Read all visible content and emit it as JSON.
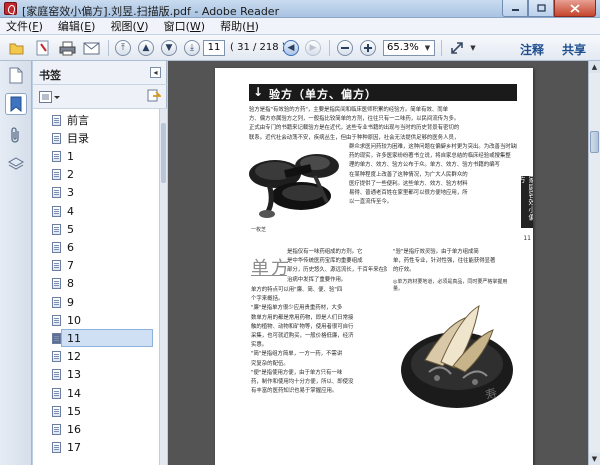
{
  "window": {
    "title": "[家庭窑效小偏方].刘昱.扫描版.pdf - Adobe Reader",
    "min_icon": "minimize-glyph",
    "max_icon": "maximize-glyph",
    "close_icon": "close-glyph"
  },
  "menu": {
    "items": [
      {
        "label": "文件(",
        "key": "F",
        "end": ")"
      },
      {
        "label": "编辑(",
        "key": "E",
        "end": ")"
      },
      {
        "label": "视图(",
        "key": "V",
        "end": ")"
      },
      {
        "label": "窗口(",
        "key": "W",
        "end": ")"
      },
      {
        "label": "帮助(",
        "key": "H",
        "end": ")"
      }
    ]
  },
  "toolbar": {
    "page_value": "11",
    "page_count": "( 31 / 218 )",
    "zoom_value": "65.3%",
    "annotate_label": "注释",
    "share_label": "共享"
  },
  "bookmarks": {
    "title": "书签",
    "items": [
      {
        "label": "前言"
      },
      {
        "label": "目录"
      },
      {
        "label": "1"
      },
      {
        "label": "2"
      },
      {
        "label": "3"
      },
      {
        "label": "4"
      },
      {
        "label": "5"
      },
      {
        "label": "6"
      },
      {
        "label": "7"
      },
      {
        "label": "8"
      },
      {
        "label": "9"
      },
      {
        "label": "10"
      },
      {
        "label": "11",
        "selected": true
      },
      {
        "label": "12"
      },
      {
        "label": "13"
      },
      {
        "label": "14"
      },
      {
        "label": "15"
      },
      {
        "label": "16"
      },
      {
        "label": "17"
      }
    ]
  },
  "document": {
    "header_title": "验方（单方、偏方）",
    "side_tab": "家庭容效小偏方",
    "page_number": "11",
    "para1": [
      "验方是指\"有效验的方药\"，主要是指民间和临床医师积累的经验方。简单有效、而单",
      "方、偏方亦属验方之列，一般指比较简单的方剂，往往只有一二味药，以民间流传为多。",
      "正式由专门的书籍来记载验方是在近代，这些专业书籍的出现与当时的历史背景有密切的",
      "联系。近代社会动荡不安，疾病丛生，但由于种种原因，社会无法提供足够的医务人员，"
    ],
    "para2": [
      "群众求医问药较为困难，这种问题在偏僻乡村更为突出。为改善当时缺医少",
      "药的现实，许多医家纷纷著书立说，将自家总结的临床经验或搜集整",
      "理的单方、效方、验方公布于众。单方、效方、验方书籍的编写",
      "在某种程度上改善了这种情况，为广大人民群众的",
      "医疗提供了一些便利。这些单方、效方、验方材料",
      "易得、普通老百姓在家里都可以很方便地应用，所",
      "以一直流传至今。"
    ],
    "caption1": "一枚芝",
    "heading_big": "单方",
    "para3": [
      "是指仅有一味药组成的方剂。它",
      "是中华传统医药宝库的重要组成",
      "部分，历史悠久、源远流长，千百年来在防病",
      "治病中发挥了重要作用。"
    ],
    "para4": [
      "单方的特点可以用\"廉、简、便、验\"四",
      "个字来概括。",
      "\"廉\"是指单方很少应用贵重药材，大多",
      "数单方用的都是常用药物，即是人们日常接",
      "触的植物、动物和矿物等，使用者很可自行",
      "采集，也可就近购买，一般价格低廉，经济",
      "实惠。",
      "\"简\"是指组方简单，一方一药，不需讲",
      "究复杂的配伍。",
      "\"便\"是指使用方便，由于单方只有一味",
      "药，制作和使用均十分方便，所以、即使没",
      "有丰富的医药知识也易于掌握应用。"
    ],
    "para5": [
      "\"验\"是指疗效灵验。由于单方组成简",
      "单，药性专业，针对性强，往往能获得显著",
      "的疗效。"
    ],
    "caption2": "◎单方药材要地道，必须是真品，同时要严格掌握用量。"
  }
}
